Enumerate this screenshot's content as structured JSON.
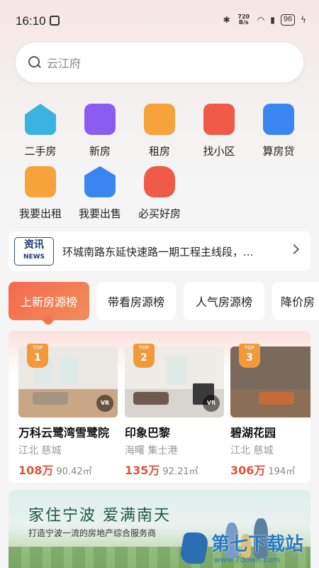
{
  "status_bar": {
    "time": "16:10",
    "network_speed": "720 B/s",
    "battery": "96"
  },
  "search": {
    "placeholder": "云江府"
  },
  "quick_links": [
    {
      "label": "二手房",
      "icon": "house-icon",
      "color": "#3bb3e0"
    },
    {
      "label": "新房",
      "icon": "building-icon",
      "color": "#8a5cf0"
    },
    {
      "label": "租房",
      "icon": "suitcase-icon",
      "color": "#f5a33a"
    },
    {
      "label": "找小区",
      "icon": "community-icon",
      "color": "#ee5a45"
    },
    {
      "label": "算房贷",
      "icon": "calculator-icon",
      "color": "#3a86f0"
    },
    {
      "label": "我要出租",
      "icon": "rent-out-icon",
      "color": "#f5a33a"
    },
    {
      "label": "我要出售",
      "icon": "sell-icon",
      "color": "#3a86f0"
    },
    {
      "label": "必买好房",
      "icon": "crown-bag-icon",
      "color": "#ee5a45"
    }
  ],
  "news": {
    "badge_title": "资讯",
    "badge_sub": "NEWS",
    "text": "环城南路东延快速路一期工程主线段，..."
  },
  "tabs": [
    {
      "label": "上新房源榜",
      "active": true
    },
    {
      "label": "带看房源榜",
      "active": false
    },
    {
      "label": "人气房源榜",
      "active": false
    },
    {
      "label": "降价房",
      "active": false
    }
  ],
  "listings": [
    {
      "rank_label": "TOP",
      "rank": "1",
      "name": "万科云鹭湾雪鹭院",
      "area": "江北 慈城",
      "price": "108万",
      "size": "90.42㎡",
      "vr": "VR"
    },
    {
      "rank_label": "TOP",
      "rank": "2",
      "name": "印象巴黎",
      "area": "海曙 集士港",
      "price": "135万",
      "size": "92.21㎡",
      "vr": "VR"
    },
    {
      "rank_label": "TOP",
      "rank": "3",
      "name": "碧湖花园",
      "area": "江北 慈城",
      "price": "306万",
      "size": "194㎡",
      "vr": ""
    }
  ],
  "banner": {
    "title": "家住宁波 爱满南天",
    "subtitle": "打造宁波一流的房地产综合服务商"
  },
  "watermark": {
    "text": "第七下载站",
    "url": "www.7down.com"
  }
}
